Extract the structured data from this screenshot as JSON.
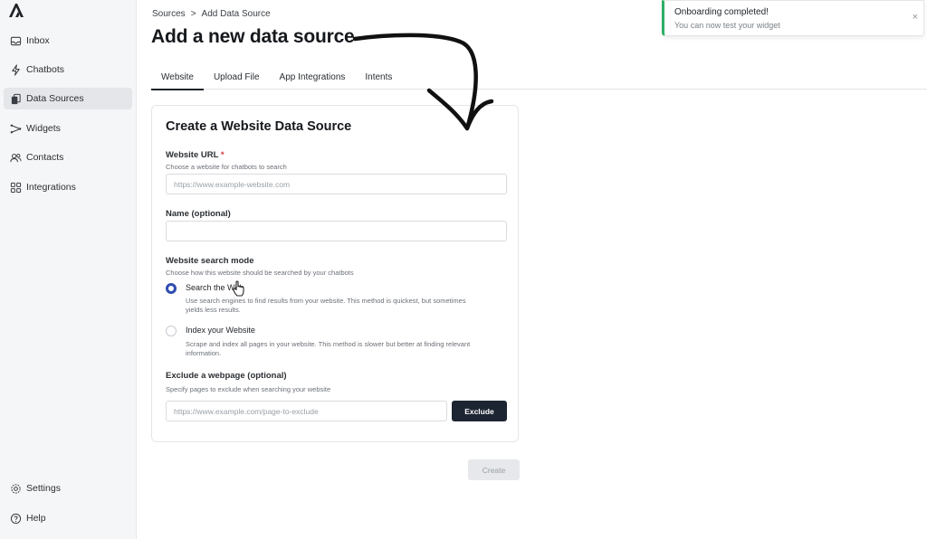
{
  "sidebar": {
    "items": [
      {
        "label": "Inbox",
        "icon": "inbox-icon"
      },
      {
        "label": "Chatbots",
        "icon": "bolt-icon"
      },
      {
        "label": "Data Sources",
        "icon": "documents-icon"
      },
      {
        "label": "Widgets",
        "icon": "share-icon"
      },
      {
        "label": "Contacts",
        "icon": "users-icon"
      },
      {
        "label": "Integrations",
        "icon": "grid-icon"
      }
    ],
    "bottom": [
      {
        "label": "Settings",
        "icon": "gear-icon"
      },
      {
        "label": "Help",
        "icon": "help-icon"
      }
    ],
    "active_index": 2
  },
  "breadcrumb": {
    "parent": "Sources",
    "separator": ">",
    "current": "Add Data Source"
  },
  "page_title": "Add a new data source",
  "tabs": [
    {
      "label": "Website",
      "active": true
    },
    {
      "label": "Upload File",
      "active": false
    },
    {
      "label": "App Integrations",
      "active": false
    },
    {
      "label": "Intents",
      "active": false
    }
  ],
  "form": {
    "title": "Create a Website Data Source",
    "url": {
      "label": "Website URL",
      "required_mark": "*",
      "hint": "Choose a website for chatbots to search",
      "placeholder": "https://www.example-website.com",
      "value": ""
    },
    "name": {
      "label": "Name (optional)",
      "placeholder": "",
      "value": ""
    },
    "search_mode": {
      "label": "Website search mode",
      "hint": "Choose how this website should be searched by your chatbots",
      "options": [
        {
          "label": "Search the Web",
          "desc": "Use search engines to find results from your website. This method is quickest, but sometimes yields less results.",
          "checked": true
        },
        {
          "label": "Index your Website",
          "desc": "Scrape and index all pages in your website. This method is slower but better at finding relevant information.",
          "checked": false
        }
      ]
    },
    "exclude": {
      "label": "Exclude a webpage (optional)",
      "hint": "Specify pages to exclude when searching your website",
      "placeholder": "https://www.example.com/page-to-exclude",
      "button": "Exclude"
    },
    "create_button": "Create"
  },
  "toast": {
    "title": "Onboarding completed!",
    "message": "You can now test your widget",
    "close": "×",
    "accent": "#2fae65"
  },
  "colors": {
    "primary_button": "#1e2532",
    "radio_selected": "#2f4db1",
    "sidebar_bg": "#f5f6f7"
  }
}
